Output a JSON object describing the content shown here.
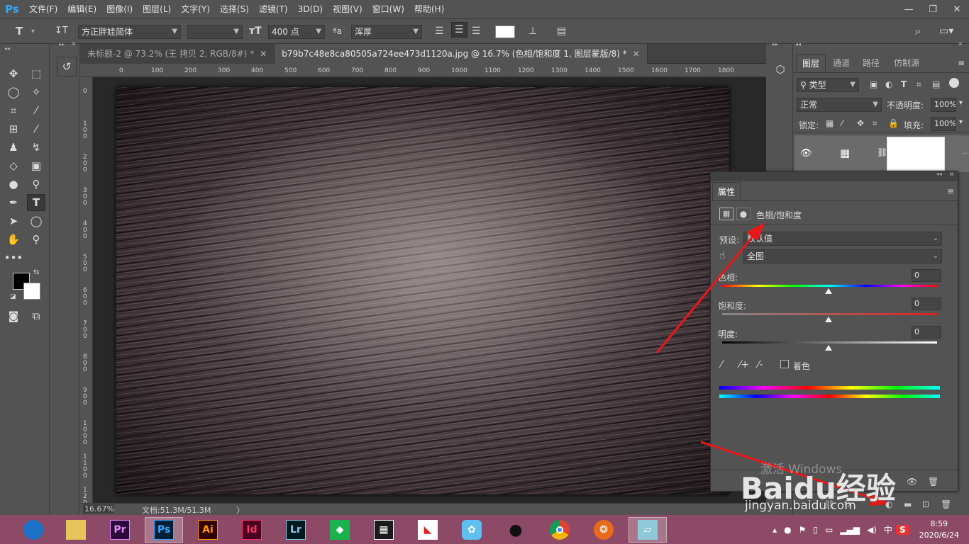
{
  "app": {
    "logo": "Ps"
  },
  "menu": [
    "文件(F)",
    "编辑(E)",
    "图像(I)",
    "图层(L)",
    "文字(Y)",
    "选择(S)",
    "滤镜(T)",
    "3D(D)",
    "视图(V)",
    "窗口(W)",
    "帮助(H)"
  ],
  "window_controls": {
    "minimize": "—",
    "restore": "❐",
    "close": "✕"
  },
  "options": {
    "font_family": "方正胖娃简体",
    "font_style": "",
    "font_size": "400 点",
    "antialias_label": "ªa",
    "antialias": "浑厚"
  },
  "tabs": [
    {
      "label": "未标题-2 @ 73.2% (王 拷贝 2, RGB/8#) *",
      "active": false
    },
    {
      "label": "b79b7c48e8ca80505a724ee473d1120a.jpg @ 16.7% (色相/饱和度 1, 图层蒙版/8) *",
      "active": true
    }
  ],
  "ruler_h": [
    "0",
    "100",
    "200",
    "300",
    "400",
    "500",
    "600",
    "700",
    "800",
    "900",
    "1000",
    "1100",
    "1200",
    "1300",
    "1400",
    "1500",
    "1600",
    "1700",
    "1800"
  ],
  "ruler_v": [
    "0",
    "100",
    "200",
    "300",
    "400",
    "500",
    "600",
    "700",
    "800",
    "900",
    "1000",
    "1100",
    "1200"
  ],
  "status": {
    "zoom": "16.67%",
    "doc": "文档:51.3M/51.3M",
    "arrow": "〉"
  },
  "layers_panel": {
    "tabs": [
      "图层",
      "通道",
      "路径",
      "仿制源"
    ],
    "filter_label": "类型",
    "blend_mode": "正常",
    "opacity_label": "不透明度:",
    "opacity": "100%",
    "lock_label": "锁定:",
    "fill_label": "填充:",
    "fill": "100%"
  },
  "properties": {
    "title": "属性",
    "adjustment": "色相/饱和度",
    "preset_label": "预设:",
    "preset_value": "默认值",
    "channel_value": "全图",
    "hue_label": "色相:",
    "hue": "0",
    "saturation_label": "饱和度:",
    "saturation": "0",
    "lightness_label": "明度:",
    "lightness": "0",
    "colorize_label": "着色"
  },
  "watermark": {
    "text": "Baidu经验",
    "url": "jingyan.baidu.com",
    "activate": "激活 Windows"
  },
  "taskbar": {
    "apps": [
      {
        "name": "browser-360",
        "label": "",
        "bg": "#1a73c8",
        "fg": "#ffffff"
      },
      {
        "name": "file-explorer",
        "label": "",
        "bg": "#e8c55a",
        "fg": "#6b4a12"
      },
      {
        "name": "premiere",
        "label": "Pr",
        "bg": "#2a0a3c",
        "fg": "#e38cf5"
      },
      {
        "name": "photoshop",
        "label": "Ps",
        "bg": "#001e36",
        "fg": "#31a8ff"
      },
      {
        "name": "illustrator",
        "label": "Ai",
        "bg": "#330000",
        "fg": "#ff9a00"
      },
      {
        "name": "indesign",
        "label": "Id",
        "bg": "#49021f",
        "fg": "#ff3366"
      },
      {
        "name": "lightroom",
        "label": "Lr",
        "bg": "#001a1f",
        "fg": "#8ec6e8"
      },
      {
        "name": "app-green",
        "label": "",
        "bg": "#19b34d",
        "fg": "#ffffff"
      },
      {
        "name": "video-editor",
        "label": "",
        "bg": "#1a1a1a",
        "fg": "#ffffff"
      },
      {
        "name": "app-red-green",
        "label": "",
        "bg": "#ffffff",
        "fg": "#d22"
      },
      {
        "name": "app-bird",
        "label": "",
        "bg": "#5ec0f0",
        "fg": "#ffffff"
      },
      {
        "name": "qq",
        "label": "",
        "bg": "#111111",
        "fg": "#ffcc00"
      },
      {
        "name": "chrome",
        "label": "",
        "bg": "#ffffff",
        "fg": "#db4437"
      },
      {
        "name": "app-orange",
        "label": "",
        "bg": "#e86a1a",
        "fg": "#ffffff"
      },
      {
        "name": "app-note",
        "label": "",
        "bg": "#8ec9d9",
        "fg": "#ffffff"
      }
    ],
    "tray": {
      "ime": "中",
      "sogou": "S",
      "time": "8:59",
      "date": "2020/6/24"
    }
  },
  "colors": {
    "accent": "#31a8ff",
    "arrow": "#e81818",
    "taskbar": "#8d4a66"
  }
}
